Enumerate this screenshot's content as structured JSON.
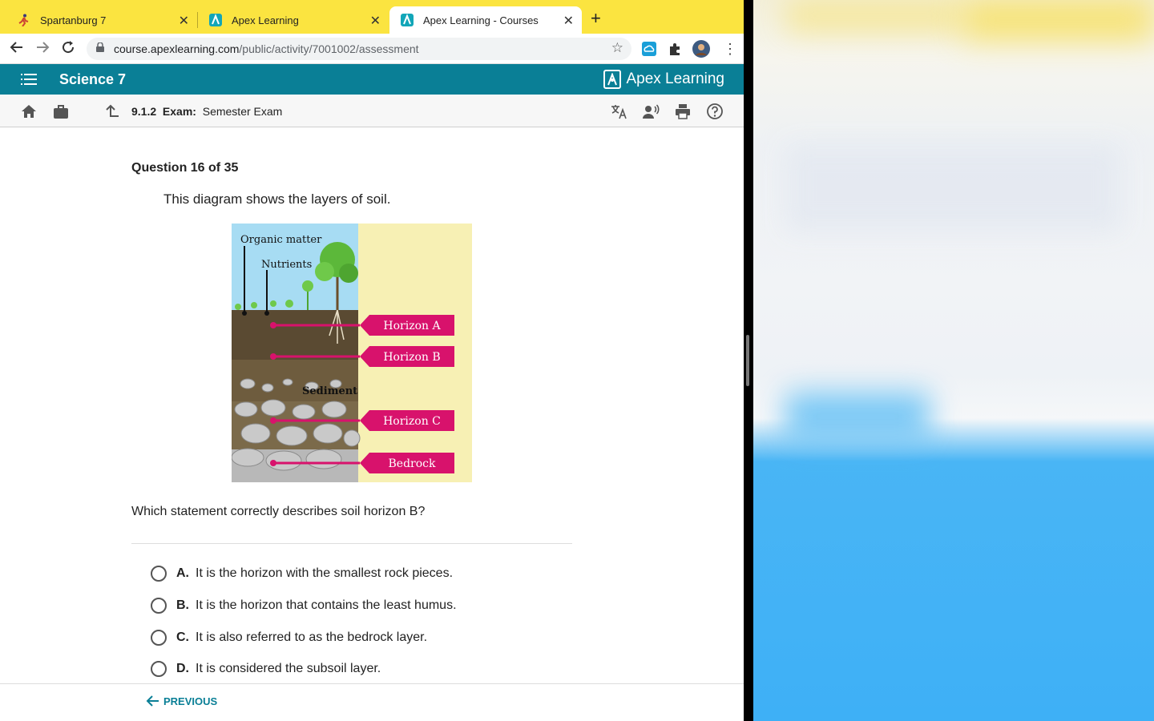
{
  "tabs": [
    {
      "title": "Spartanburg 7",
      "favicon": "runner-favicon"
    },
    {
      "title": "Apex Learning",
      "favicon": "apex-favicon"
    },
    {
      "title": "Apex Learning - Courses",
      "favicon": "apex-favicon",
      "active": true
    }
  ],
  "address_bar": {
    "domain": "course.apexlearning.com",
    "path": "/public/activity/7001002/assessment"
  },
  "app_header": {
    "course_title": "Science 7",
    "brand": "Apex Learning"
  },
  "breadcrumb": {
    "number": "9.1.2",
    "type": "Exam:",
    "title": "Semester Exam"
  },
  "question": {
    "counter": "Question 16 of 35",
    "intro": "This diagram shows the layers of soil.",
    "prompt": "Which statement correctly describes soil horizon B?",
    "choices": [
      {
        "letter": "A.",
        "text": "It is the horizon with the smallest rock pieces."
      },
      {
        "letter": "B.",
        "text": "It is the horizon that contains the least humus."
      },
      {
        "letter": "C.",
        "text": "It is also referred to as the bedrock layer."
      },
      {
        "letter": "D.",
        "text": "It is considered the subsoil layer."
      }
    ]
  },
  "diagram": {
    "labels": {
      "organic": "Organic matter",
      "nutrients": "Nutrients",
      "sediment": "Sediment",
      "horizon_a": "Horizon A",
      "horizon_b": "Horizon B",
      "horizon_c": "Horizon C",
      "bedrock": "Bedrock"
    },
    "colors": {
      "sky": "#a7dcf3",
      "panel": "#f7f0b4",
      "tag": "#d8126c",
      "topsoil": "#5a4a32",
      "rock": "#b8b8b8"
    }
  },
  "footer": {
    "previous": "PREVIOUS"
  },
  "colors": {
    "tabstrip": "#fbe440",
    "appbar": "#0a7f96",
    "accent": "#0a7f96"
  }
}
